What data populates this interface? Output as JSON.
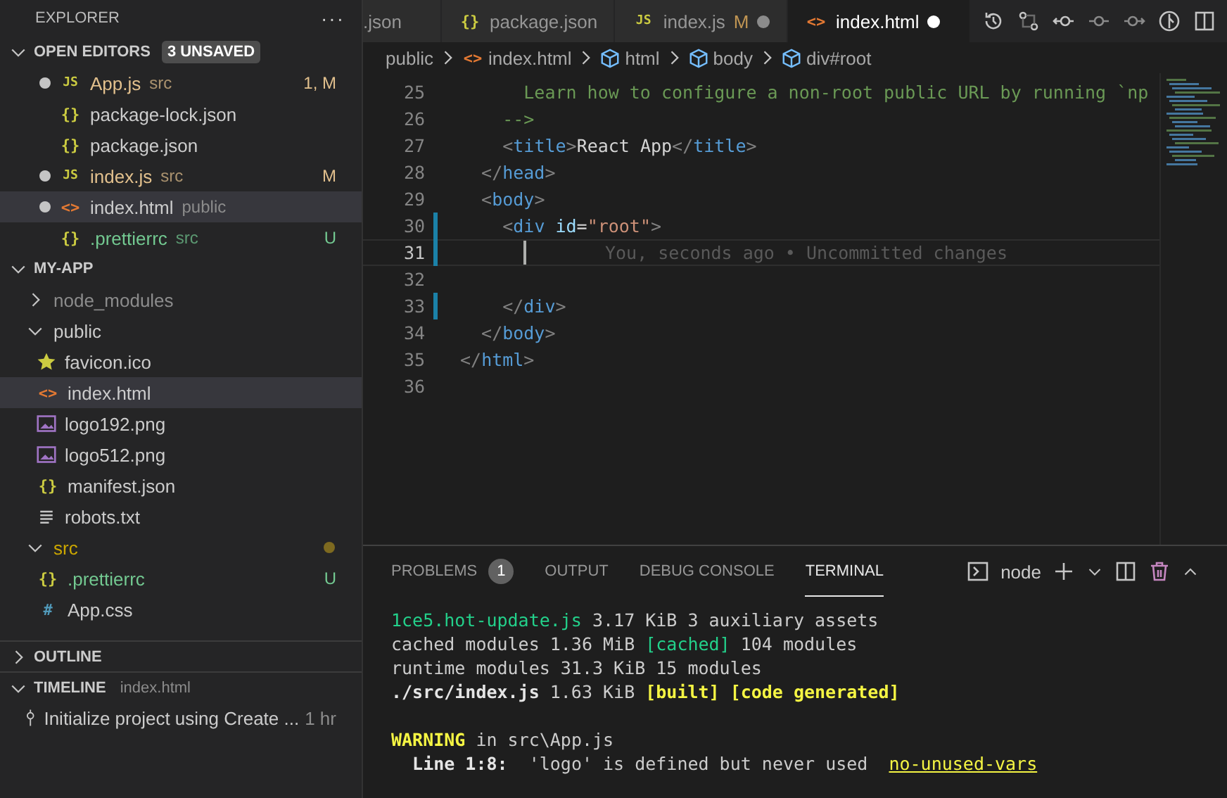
{
  "sidebar": {
    "title": "EXPLORER",
    "more": "···",
    "open_editors": {
      "title": "OPEN EDITORS",
      "badge": "3 UNSAVED",
      "expanded": true,
      "items": [
        {
          "kind": "js",
          "glyph": "JS",
          "name": "App.js",
          "description": "src",
          "color": "#e2c08d",
          "badge": "1, M",
          "unsaved": true,
          "selected": false
        },
        {
          "kind": "json",
          "glyph": "{}",
          "name": "package-lock.json",
          "color": "#cccccc",
          "unsaved": false,
          "selected": false
        },
        {
          "kind": "json",
          "glyph": "{}",
          "name": "package.json",
          "color": "#cccccc",
          "unsaved": false,
          "selected": false
        },
        {
          "kind": "js",
          "glyph": "JS",
          "name": "index.js",
          "description": "src",
          "color": "#e2c08d",
          "badge": "M",
          "unsaved": true,
          "selected": false
        },
        {
          "kind": "html",
          "glyph": "<>",
          "name": "index.html",
          "description": "public",
          "color": "#cccccc",
          "unsaved": true,
          "selected": true
        },
        {
          "kind": "json",
          "glyph": "{}",
          "name": ".prettierrc",
          "description": "src",
          "color": "#73c991",
          "badge": "U",
          "unsaved": false,
          "selected": false
        }
      ]
    },
    "project": {
      "title": "MY-APP",
      "expanded": true,
      "tree": [
        {
          "kind": "folder",
          "name": "node_modules",
          "expanded": false,
          "color": "#8c8c8c",
          "selected": false
        },
        {
          "kind": "folder",
          "name": "public",
          "expanded": true,
          "color": "#cccccc",
          "selected": false,
          "children": [
            {
              "kind": "ico",
              "name": "favicon.ico",
              "color": "#cccccc",
              "selected": false
            },
            {
              "kind": "html",
              "glyph": "<>",
              "name": "index.html",
              "color": "#cccccc",
              "selected": true
            },
            {
              "kind": "png",
              "name": "logo192.png",
              "color": "#cccccc",
              "selected": false
            },
            {
              "kind": "png",
              "name": "logo512.png",
              "color": "#cccccc",
              "selected": false
            },
            {
              "kind": "json",
              "glyph": "{}",
              "name": "manifest.json",
              "color": "#cccccc",
              "selected": false
            },
            {
              "kind": "txt",
              "name": "robots.txt",
              "color": "#cccccc",
              "selected": false
            }
          ]
        },
        {
          "kind": "folder",
          "name": "src",
          "expanded": true,
          "color": "#cca700",
          "modified": true,
          "selected": false,
          "children": [
            {
              "kind": "json",
              "glyph": "{}",
              "name": ".prettierrc",
              "color": "#73c991",
              "badge": "U",
              "selected": false
            },
            {
              "kind": "css",
              "glyph": "#",
              "name": "App.css",
              "color": "#cccccc",
              "selected": false
            }
          ]
        }
      ]
    },
    "outline": {
      "title": "OUTLINE",
      "expanded": false
    },
    "timeline": {
      "title": "TIMELINE",
      "file": "index.html",
      "expanded": true,
      "items": [
        {
          "label": "Initialize project using Create ...",
          "time": "1 hr"
        }
      ]
    }
  },
  "tabs": [
    {
      "kind": "json",
      "name": ".json",
      "selected": false,
      "unsaved": false
    },
    {
      "kind": "json",
      "glyph": "{}",
      "name": "package.json",
      "selected": false,
      "unsaved": false
    },
    {
      "kind": "js",
      "glyph": "JS",
      "name": "index.js",
      "badge": "M",
      "selected": false,
      "unsaved": true
    },
    {
      "kind": "html",
      "glyph": "<>",
      "name": "index.html",
      "selected": true,
      "unsaved": true
    }
  ],
  "breadcrumbs": [
    {
      "kind": "folder",
      "label": "public"
    },
    {
      "kind": "html",
      "glyph": "<>",
      "label": "index.html"
    },
    {
      "kind": "element",
      "label": "html"
    },
    {
      "kind": "element",
      "label": "body"
    },
    {
      "kind": "element",
      "label": "div#root"
    }
  ],
  "code": [
    {
      "number": "25",
      "current": false,
      "modified": false,
      "tokens": [
        {
          "kind": "comment",
          "text": "      Learn how to configure a non-root public URL by running `np"
        }
      ]
    },
    {
      "number": "26",
      "current": false,
      "modified": false,
      "tokens": [
        {
          "kind": "comment",
          "text": "    -->"
        }
      ]
    },
    {
      "number": "27",
      "current": false,
      "modified": false,
      "tokens": [
        {
          "kind": "punct",
          "text": "    <"
        },
        {
          "kind": "tag",
          "text": "title"
        },
        {
          "kind": "punct",
          "text": ">"
        },
        {
          "kind": "text",
          "text": "React App"
        },
        {
          "kind": "punct",
          "text": "</"
        },
        {
          "kind": "tag",
          "text": "title"
        },
        {
          "kind": "punct",
          "text": ">"
        }
      ]
    },
    {
      "number": "28",
      "current": false,
      "modified": false,
      "tokens": [
        {
          "kind": "punct",
          "text": "  </"
        },
        {
          "kind": "tag",
          "text": "head"
        },
        {
          "kind": "punct",
          "text": ">"
        }
      ]
    },
    {
      "number": "29",
      "current": false,
      "modified": false,
      "tokens": [
        {
          "kind": "punct",
          "text": "  <"
        },
        {
          "kind": "tag",
          "text": "body"
        },
        {
          "kind": "punct",
          "text": ">"
        }
      ]
    },
    {
      "number": "30",
      "current": false,
      "modified": true,
      "tokens": [
        {
          "kind": "punct",
          "text": "    <"
        },
        {
          "kind": "tag",
          "text": "div"
        },
        {
          "kind": "attr",
          "text": " id"
        },
        {
          "kind": "text",
          "text": "="
        },
        {
          "kind": "string",
          "text": "\"root\""
        },
        {
          "kind": "punct",
          "text": ">"
        }
      ]
    },
    {
      "number": "31",
      "current": true,
      "modified": true,
      "blame": "You, seconds ago • Uncommitted changes"
    },
    {
      "number": "32",
      "current": false,
      "modified": false
    },
    {
      "number": "33",
      "current": false,
      "modified": true,
      "tokens": [
        {
          "kind": "punct",
          "text": "    </"
        },
        {
          "kind": "tag",
          "text": "div"
        },
        {
          "kind": "punct",
          "text": ">"
        }
      ]
    },
    {
      "number": "34",
      "current": false,
      "modified": false,
      "tokens": [
        {
          "kind": "punct",
          "text": "  </"
        },
        {
          "kind": "tag",
          "text": "body"
        },
        {
          "kind": "punct",
          "text": ">"
        }
      ]
    },
    {
      "number": "35",
      "current": false,
      "modified": false,
      "tokens": [
        {
          "kind": "punct",
          "text": "</"
        },
        {
          "kind": "tag",
          "text": "html"
        },
        {
          "kind": "punct",
          "text": ">"
        }
      ]
    },
    {
      "number": "36",
      "current": false,
      "modified": false
    }
  ],
  "panel": {
    "tabs": [
      {
        "label": "PROBLEMS",
        "badge": "1",
        "selected": false
      },
      {
        "label": "OUTPUT",
        "selected": false
      },
      {
        "label": "DEBUG CONSOLE",
        "selected": false
      },
      {
        "label": "TERMINAL",
        "selected": true
      }
    ],
    "terminal_name": "node",
    "lines": [
      {
        "kind": "output",
        "segments": [
          {
            "kind": "green",
            "text": "1ce5.hot-update.js"
          },
          {
            "kind": "plain",
            "text": " 3.17 KiB 3 auxiliary assets"
          }
        ]
      },
      {
        "kind": "output",
        "segments": [
          {
            "kind": "plain",
            "text": "cached modules 1.36 MiB "
          },
          {
            "kind": "green",
            "text": "[cached]"
          },
          {
            "kind": "plain",
            "text": " 104 modules"
          }
        ]
      },
      {
        "kind": "output",
        "segments": [
          {
            "kind": "plain",
            "text": "runtime modules 31.3 KiB 15 modules"
          }
        ]
      },
      {
        "kind": "output",
        "segments": [
          {
            "kind": "bold",
            "text": "./src/index.js"
          },
          {
            "kind": "plain",
            "text": " 1.63 KiB "
          },
          {
            "kind": "yellow",
            "text": "[built] [code generated]"
          }
        ]
      },
      {
        "kind": "blank"
      },
      {
        "kind": "output",
        "segments": [
          {
            "kind": "yellow",
            "text": "WARNING"
          },
          {
            "kind": "plain",
            "text": " in src\\App.js"
          }
        ]
      },
      {
        "kind": "output",
        "segments": [
          {
            "kind": "bold",
            "text": "  Line 1:8:"
          },
          {
            "kind": "plain",
            "text": "  'logo' is defined but never used  "
          },
          {
            "kind": "link",
            "text": "no-unused-vars"
          }
        ]
      }
    ]
  }
}
